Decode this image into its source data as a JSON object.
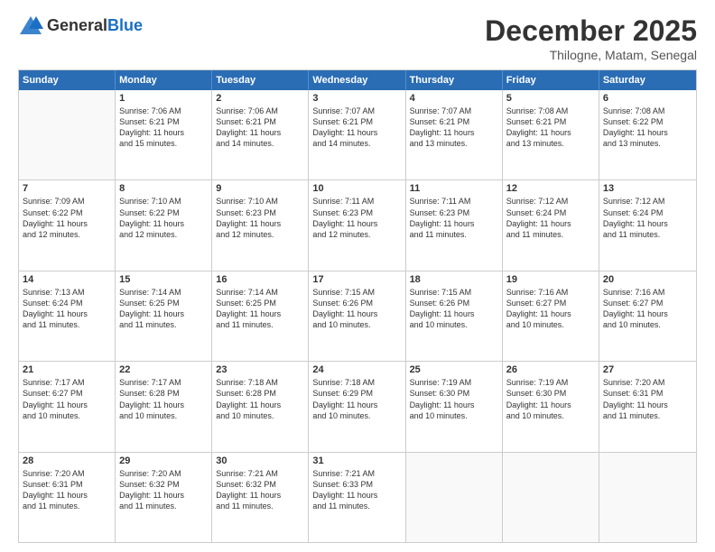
{
  "header": {
    "logo_general": "General",
    "logo_blue": "Blue",
    "title": "December 2025",
    "location": "Thilogne, Matam, Senegal"
  },
  "weekdays": [
    "Sunday",
    "Monday",
    "Tuesday",
    "Wednesday",
    "Thursday",
    "Friday",
    "Saturday"
  ],
  "rows": [
    [
      {
        "day": "",
        "info": ""
      },
      {
        "day": "1",
        "info": "Sunrise: 7:06 AM\nSunset: 6:21 PM\nDaylight: 11 hours\nand 15 minutes."
      },
      {
        "day": "2",
        "info": "Sunrise: 7:06 AM\nSunset: 6:21 PM\nDaylight: 11 hours\nand 14 minutes."
      },
      {
        "day": "3",
        "info": "Sunrise: 7:07 AM\nSunset: 6:21 PM\nDaylight: 11 hours\nand 14 minutes."
      },
      {
        "day": "4",
        "info": "Sunrise: 7:07 AM\nSunset: 6:21 PM\nDaylight: 11 hours\nand 13 minutes."
      },
      {
        "day": "5",
        "info": "Sunrise: 7:08 AM\nSunset: 6:21 PM\nDaylight: 11 hours\nand 13 minutes."
      },
      {
        "day": "6",
        "info": "Sunrise: 7:08 AM\nSunset: 6:22 PM\nDaylight: 11 hours\nand 13 minutes."
      }
    ],
    [
      {
        "day": "7",
        "info": "Sunrise: 7:09 AM\nSunset: 6:22 PM\nDaylight: 11 hours\nand 12 minutes."
      },
      {
        "day": "8",
        "info": "Sunrise: 7:10 AM\nSunset: 6:22 PM\nDaylight: 11 hours\nand 12 minutes."
      },
      {
        "day": "9",
        "info": "Sunrise: 7:10 AM\nSunset: 6:23 PM\nDaylight: 11 hours\nand 12 minutes."
      },
      {
        "day": "10",
        "info": "Sunrise: 7:11 AM\nSunset: 6:23 PM\nDaylight: 11 hours\nand 12 minutes."
      },
      {
        "day": "11",
        "info": "Sunrise: 7:11 AM\nSunset: 6:23 PM\nDaylight: 11 hours\nand 11 minutes."
      },
      {
        "day": "12",
        "info": "Sunrise: 7:12 AM\nSunset: 6:24 PM\nDaylight: 11 hours\nand 11 minutes."
      },
      {
        "day": "13",
        "info": "Sunrise: 7:12 AM\nSunset: 6:24 PM\nDaylight: 11 hours\nand 11 minutes."
      }
    ],
    [
      {
        "day": "14",
        "info": "Sunrise: 7:13 AM\nSunset: 6:24 PM\nDaylight: 11 hours\nand 11 minutes."
      },
      {
        "day": "15",
        "info": "Sunrise: 7:14 AM\nSunset: 6:25 PM\nDaylight: 11 hours\nand 11 minutes."
      },
      {
        "day": "16",
        "info": "Sunrise: 7:14 AM\nSunset: 6:25 PM\nDaylight: 11 hours\nand 11 minutes."
      },
      {
        "day": "17",
        "info": "Sunrise: 7:15 AM\nSunset: 6:26 PM\nDaylight: 11 hours\nand 10 minutes."
      },
      {
        "day": "18",
        "info": "Sunrise: 7:15 AM\nSunset: 6:26 PM\nDaylight: 11 hours\nand 10 minutes."
      },
      {
        "day": "19",
        "info": "Sunrise: 7:16 AM\nSunset: 6:27 PM\nDaylight: 11 hours\nand 10 minutes."
      },
      {
        "day": "20",
        "info": "Sunrise: 7:16 AM\nSunset: 6:27 PM\nDaylight: 11 hours\nand 10 minutes."
      }
    ],
    [
      {
        "day": "21",
        "info": "Sunrise: 7:17 AM\nSunset: 6:27 PM\nDaylight: 11 hours\nand 10 minutes."
      },
      {
        "day": "22",
        "info": "Sunrise: 7:17 AM\nSunset: 6:28 PM\nDaylight: 11 hours\nand 10 minutes."
      },
      {
        "day": "23",
        "info": "Sunrise: 7:18 AM\nSunset: 6:28 PM\nDaylight: 11 hours\nand 10 minutes."
      },
      {
        "day": "24",
        "info": "Sunrise: 7:18 AM\nSunset: 6:29 PM\nDaylight: 11 hours\nand 10 minutes."
      },
      {
        "day": "25",
        "info": "Sunrise: 7:19 AM\nSunset: 6:30 PM\nDaylight: 11 hours\nand 10 minutes."
      },
      {
        "day": "26",
        "info": "Sunrise: 7:19 AM\nSunset: 6:30 PM\nDaylight: 11 hours\nand 10 minutes."
      },
      {
        "day": "27",
        "info": "Sunrise: 7:20 AM\nSunset: 6:31 PM\nDaylight: 11 hours\nand 11 minutes."
      }
    ],
    [
      {
        "day": "28",
        "info": "Sunrise: 7:20 AM\nSunset: 6:31 PM\nDaylight: 11 hours\nand 11 minutes."
      },
      {
        "day": "29",
        "info": "Sunrise: 7:20 AM\nSunset: 6:32 PM\nDaylight: 11 hours\nand 11 minutes."
      },
      {
        "day": "30",
        "info": "Sunrise: 7:21 AM\nSunset: 6:32 PM\nDaylight: 11 hours\nand 11 minutes."
      },
      {
        "day": "31",
        "info": "Sunrise: 7:21 AM\nSunset: 6:33 PM\nDaylight: 11 hours\nand 11 minutes."
      },
      {
        "day": "",
        "info": ""
      },
      {
        "day": "",
        "info": ""
      },
      {
        "day": "",
        "info": ""
      }
    ]
  ]
}
